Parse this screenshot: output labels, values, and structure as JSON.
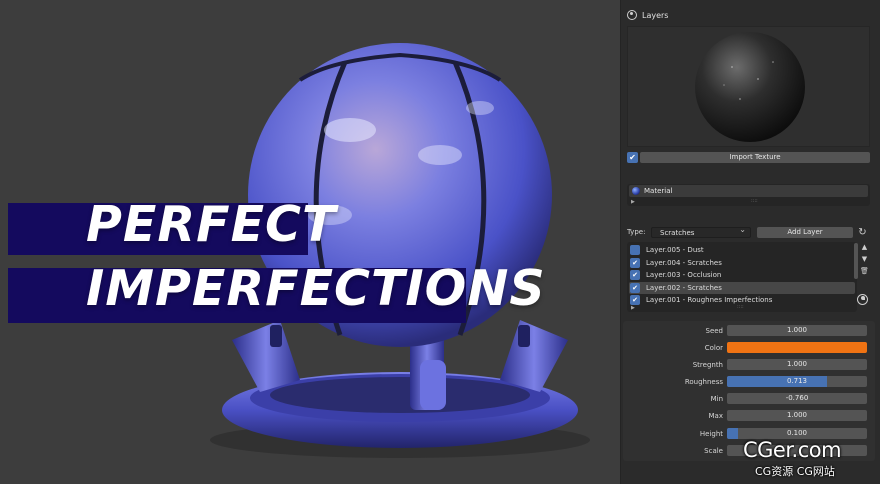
{
  "viewport": {
    "headline_line1": "PERFECT",
    "headline_line2": "IMPERFECTIONS",
    "banner_color": "#140a5e",
    "object_color": "#5a67d8"
  },
  "panel": {
    "title": "Layers",
    "import_texture_label": "Import Texture",
    "import_checked": true,
    "material_name": "Material",
    "type_label": "Type:",
    "type_value": "Scratches",
    "add_layer_label": "Add Layer",
    "layers": [
      {
        "name": "Layer.005 - Dust",
        "checked": false,
        "selected": false
      },
      {
        "name": "Layer.004 - Scratches",
        "checked": true,
        "selected": false
      },
      {
        "name": "Layer.003 - Occlusion",
        "checked": true,
        "selected": false
      },
      {
        "name": "Layer.002 - Scratches",
        "checked": true,
        "selected": true
      },
      {
        "name": "Layer.001 - Roughnes Imperfections",
        "checked": true,
        "selected": false
      }
    ],
    "properties": [
      {
        "label": "Seed",
        "value": "1.000",
        "fill": 0
      },
      {
        "label": "Color",
        "value": "",
        "color": "#f07313"
      },
      {
        "label": "Stregnth",
        "value": "1.000",
        "fill": 0
      },
      {
        "label": "Roughness",
        "value": "0.713",
        "fill": 0.713
      },
      {
        "label": "Min",
        "value": "-0.760",
        "fill": 0
      },
      {
        "label": "Max",
        "value": "1.000",
        "fill": 0
      },
      {
        "label": "Height",
        "value": "0.100",
        "fill": 0.08
      },
      {
        "label": "Scale",
        "value": "",
        "fill": 0
      }
    ],
    "accent_color": "#4772b3"
  },
  "watermark": {
    "main": "CGer.com",
    "sub": "CG资源 CG网站"
  }
}
